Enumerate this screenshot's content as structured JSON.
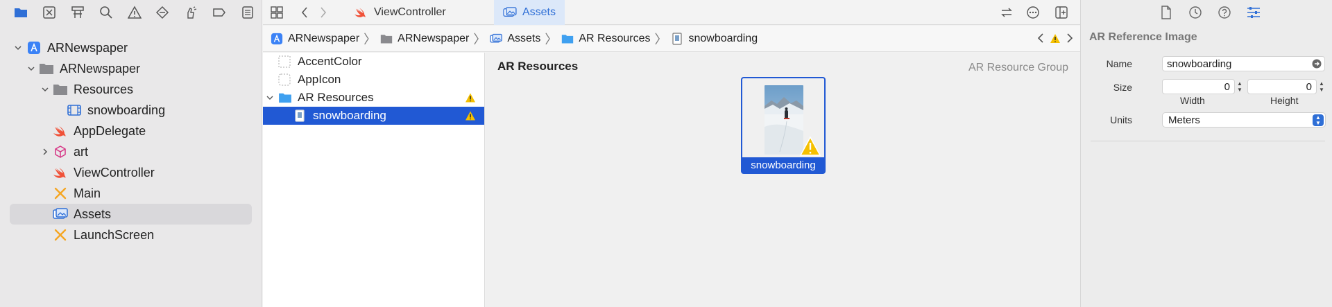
{
  "navigator": {
    "toolbar_icons": [
      "folder-icon",
      "source-control-icon",
      "symbol-icon",
      "find-icon",
      "issue-icon",
      "test-icon",
      "debug-icon",
      "breakpoint-icon",
      "report-icon"
    ],
    "tree": [
      {
        "label": "ARNewspaper",
        "icon": "xcode-project-icon",
        "expanded": true
      },
      {
        "label": "ARNewspaper",
        "icon": "folder-icon",
        "expanded": true
      },
      {
        "label": "Resources",
        "icon": "folder-icon",
        "expanded": true
      },
      {
        "label": "snowboarding",
        "icon": "film-icon"
      },
      {
        "label": "AppDelegate",
        "icon": "swift-icon"
      },
      {
        "label": "art",
        "icon": "scene-cube-icon",
        "expanded": false
      },
      {
        "label": "ViewController",
        "icon": "swift-icon"
      },
      {
        "label": "Main",
        "icon": "storyboard-icon"
      },
      {
        "label": "Assets",
        "icon": "assets-icon",
        "selected": true
      },
      {
        "label": "LaunchScreen",
        "icon": "storyboard-icon"
      }
    ]
  },
  "tabs": [
    {
      "label": "ViewController",
      "icon": "swift-icon",
      "active": false
    },
    {
      "label": "Assets",
      "icon": "assets-icon",
      "active": true
    }
  ],
  "breadcrumb": [
    "ARNewspaper",
    "ARNewspaper",
    "Assets",
    "AR Resources",
    "snowboarding"
  ],
  "asset_list": [
    {
      "label": "AccentColor",
      "icon": "color-set-icon"
    },
    {
      "label": "AppIcon",
      "icon": "app-icon-set-icon"
    },
    {
      "label": "AR Resources",
      "icon": "folder-icon",
      "warning": true,
      "expanded": true
    },
    {
      "label": "snowboarding",
      "icon": "ar-image-icon",
      "warning": true,
      "selected": true
    }
  ],
  "canvas": {
    "title": "AR Resources",
    "kind": "AR Resource Group",
    "tile_label": "snowboarding"
  },
  "inspector": {
    "title": "AR Reference Image",
    "name_label": "Name",
    "name_value": "snowboarding",
    "size_label": "Size",
    "width_value": "0",
    "height_value": "0",
    "width_label": "Width",
    "height_label": "Height",
    "units_label": "Units",
    "units_value": "Meters"
  },
  "colors": {
    "accent": "#2159d4",
    "warning": "#f5c000",
    "swift": "#f05138"
  }
}
